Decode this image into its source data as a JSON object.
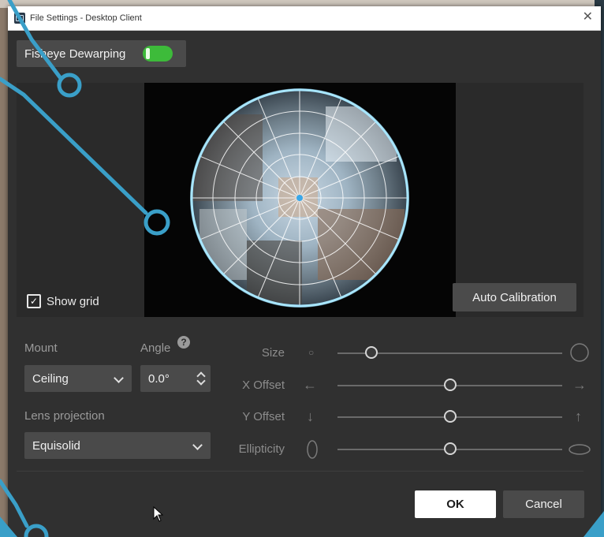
{
  "window": {
    "title": "File Settings - Desktop Client"
  },
  "toolbar": {
    "dewarp_label": "Fisheye Dewarping",
    "dewarp_enabled": true
  },
  "preview": {
    "show_grid_label": "Show grid",
    "show_grid_checked": true,
    "auto_calibration_label": "Auto Calibration"
  },
  "settings": {
    "mount_label": "Mount",
    "mount_value": "Ceiling",
    "angle_label": "Angle",
    "angle_value": "0.0°",
    "lens_label": "Lens projection",
    "lens_value": "Equisolid"
  },
  "sliders": [
    {
      "label": "Size",
      "value": 0.15
    },
    {
      "label": "X Offset",
      "value": 0.5
    },
    {
      "label": "Y Offset",
      "value": 0.5
    },
    {
      "label": "Ellipticity",
      "value": 0.5
    }
  ],
  "buttons": {
    "ok_label": "OK",
    "cancel_label": "Cancel"
  },
  "colors": {
    "toggle_on": "#3dbb3a",
    "overlay_line": "#3a9fc8",
    "window_bg": "#303030"
  }
}
